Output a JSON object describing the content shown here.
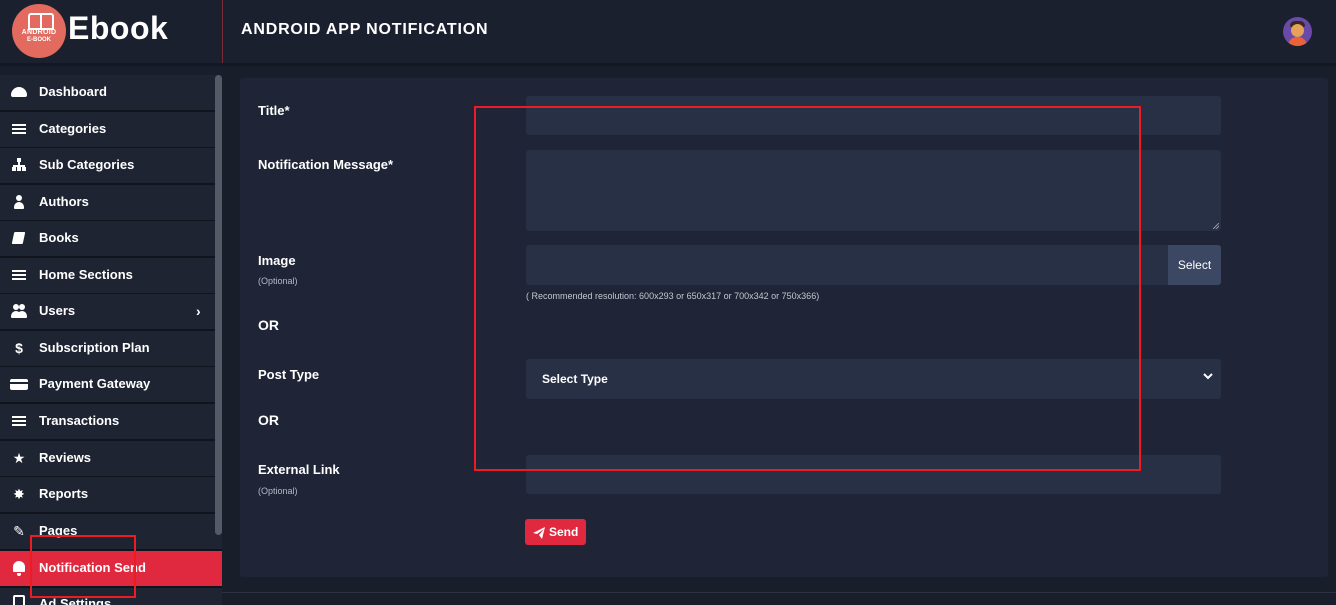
{
  "brand": {
    "name": "Ebook",
    "logo_line1": "ANDROID",
    "logo_line2": "E-BOOK"
  },
  "header": {
    "title": "ANDROID APP NOTIFICATION"
  },
  "sidebar": {
    "items": [
      {
        "label": "Dashboard",
        "icon": "dashboard-gauge-icon"
      },
      {
        "label": "Categories",
        "icon": "list-icon"
      },
      {
        "label": "Sub Categories",
        "icon": "sitemap-icon"
      },
      {
        "label": "Authors",
        "icon": "user-icon"
      },
      {
        "label": "Books",
        "icon": "book-icon"
      },
      {
        "label": "Home Sections",
        "icon": "list-icon"
      },
      {
        "label": "Users",
        "icon": "users-icon",
        "chevron": "›"
      },
      {
        "label": "Subscription Plan",
        "icon": "dollar-icon"
      },
      {
        "label": "Payment Gateway",
        "icon": "credit-card-icon"
      },
      {
        "label": "Transactions",
        "icon": "list-icon"
      },
      {
        "label": "Reviews",
        "icon": "star-icon"
      },
      {
        "label": "Reports",
        "icon": "bug-icon"
      },
      {
        "label": "Pages",
        "icon": "edit-icon"
      },
      {
        "label": "Notification Send",
        "icon": "bell-icon",
        "active": true
      },
      {
        "label": "Ad Settings",
        "icon": "ad-icon"
      }
    ],
    "glyphs": {
      "dollar": "$",
      "star": "★",
      "bug": "✸",
      "edit": "✎"
    }
  },
  "form": {
    "title_label": "Title*",
    "message_label": "Notification Message*",
    "image_label": "Image",
    "image_optional": "(Optional)",
    "image_select_button": "Select",
    "image_hint": "( Recommended resolution: 600x293 or 650x317 or 700x342 or 750x366)",
    "or_1": "OR",
    "post_type_label": "Post Type",
    "post_type_value": "Select Type",
    "or_2": "OR",
    "external_link_label": "External Link",
    "external_link_optional": "(Optional)",
    "send_label": "Send"
  },
  "colors": {
    "accent": "#e0293f",
    "background": "#191e2b",
    "card": "#1f2536",
    "input": "#283046",
    "annotation": "#ec1c24"
  }
}
